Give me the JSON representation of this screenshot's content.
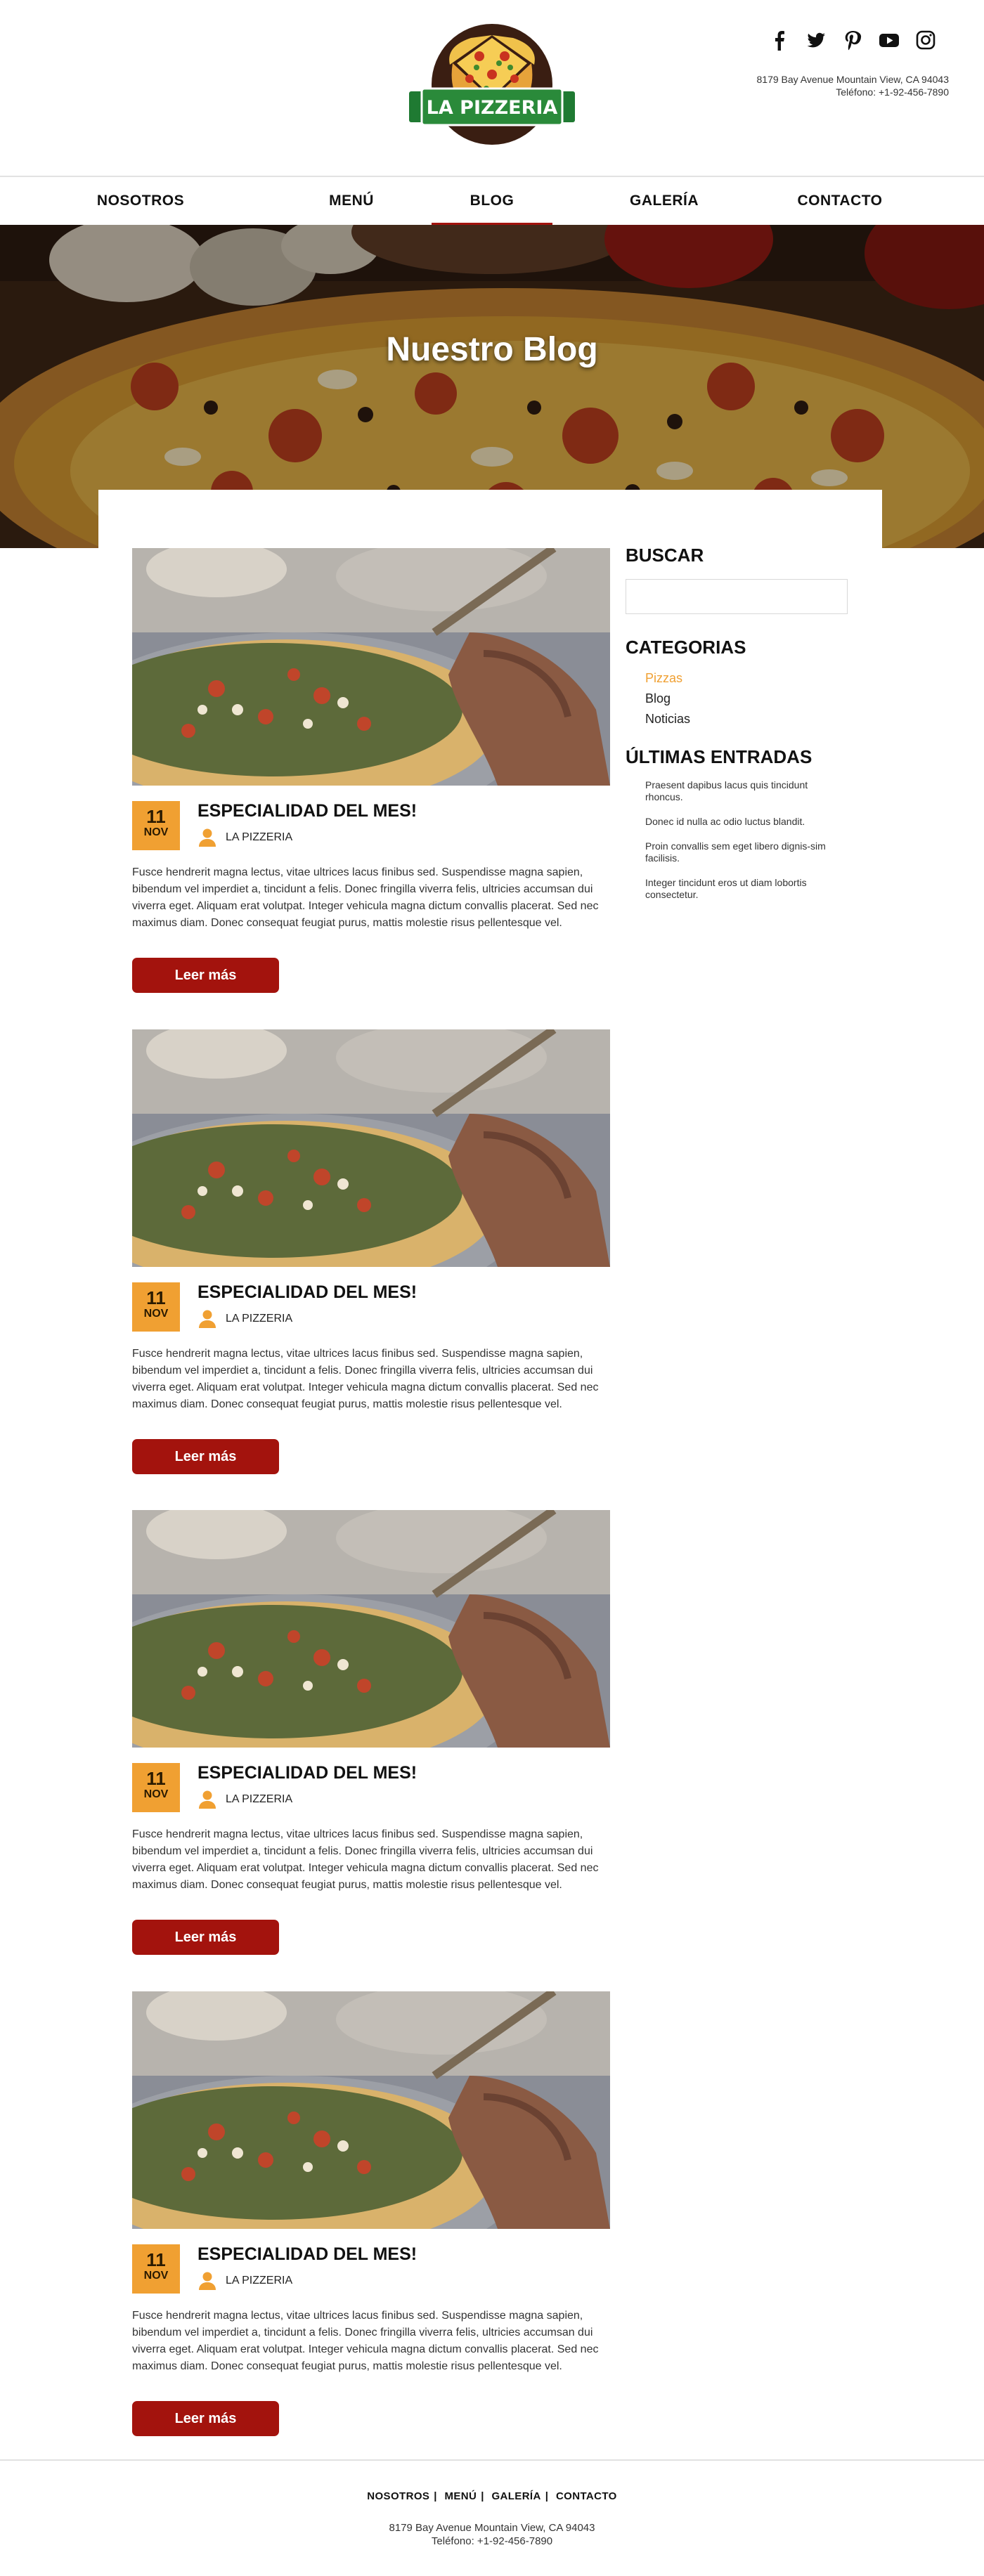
{
  "brand": {
    "name": "LA PIZZERIA"
  },
  "header": {
    "address_line1": "8179 Bay Avenue  Mountain View, CA 94043",
    "address_line2": "Teléfono: +1-92-456-7890",
    "social": [
      "facebook-icon",
      "twitter-icon",
      "pinterest-icon",
      "youtube-icon",
      "instagram-icon"
    ]
  },
  "nav": {
    "items": [
      {
        "label": "NOSOTROS"
      },
      {
        "label": "MENÚ"
      },
      {
        "label": "BLOG"
      },
      {
        "label": "GALERÍA"
      },
      {
        "label": "CONTACTO"
      }
    ],
    "active": "BLOG"
  },
  "hero": {
    "title": "Nuestro Blog"
  },
  "posts": [
    {
      "day": "11",
      "month": "NOV",
      "title": "ESPECIALIDAD DEL MES!",
      "author": "LA PIZZERIA",
      "excerpt": "Fusce hendrerit magna lectus, vitae ultrices lacus finibus sed. Suspendisse magna sapien, bibendum vel imperdiet a, tincidunt a felis. Donec fringilla viverra felis, ultricies accumsan dui viverra eget. Aliquam erat volutpat. Integer vehicula magna dictum convallis placerat. Sed nec maximus diam. Donec consequat feugiat purus, mattis molestie risus pellentesque vel.",
      "button": "Leer más"
    },
    {
      "day": "11",
      "month": "NOV",
      "title": "ESPECIALIDAD DEL MES!",
      "author": "LA PIZZERIA",
      "excerpt": "Fusce hendrerit magna lectus, vitae ultrices lacus finibus sed. Suspendisse magna sapien, bibendum vel imperdiet a, tincidunt a felis. Donec fringilla viverra felis, ultricies accumsan dui viverra eget. Aliquam erat volutpat. Integer vehicula magna dictum convallis placerat. Sed nec maximus diam. Donec consequat feugiat purus, mattis molestie risus pellentesque vel.",
      "button": "Leer más"
    },
    {
      "day": "11",
      "month": "NOV",
      "title": "ESPECIALIDAD DEL MES!",
      "author": "LA PIZZERIA",
      "excerpt": "Fusce hendrerit magna lectus, vitae ultrices lacus finibus sed. Suspendisse magna sapien, bibendum vel imperdiet a, tincidunt a felis. Donec fringilla viverra felis, ultricies accumsan dui viverra eget. Aliquam erat volutpat. Integer vehicula magna dictum convallis placerat. Sed nec maximus diam. Donec consequat feugiat purus, mattis molestie risus pellentesque vel.",
      "button": "Leer más"
    },
    {
      "day": "11",
      "month": "NOV",
      "title": "ESPECIALIDAD DEL MES!",
      "author": "LA PIZZERIA",
      "excerpt": "Fusce hendrerit magna lectus, vitae ultrices lacus finibus sed. Suspendisse magna sapien, bibendum vel imperdiet a, tincidunt a felis. Donec fringilla viverra felis, ultricies accumsan dui viverra eget. Aliquam erat volutpat. Integer vehicula magna dictum convallis placerat. Sed nec maximus diam. Donec consequat feugiat purus, mattis molestie risus pellentesque vel.",
      "button": "Leer más"
    }
  ],
  "sidebar": {
    "search_heading": "BUSCAR",
    "search_placeholder": "",
    "categories_heading": "CATEGORIAS",
    "categories": [
      {
        "label": "Pizzas",
        "active": true
      },
      {
        "label": "Blog",
        "active": false
      },
      {
        "label": "Noticias",
        "active": false
      }
    ],
    "recent_heading": "ÚLTIMAS ENTRADAS",
    "recent": [
      "Praesent dapibus lacus quis tincidunt rhoncus.",
      "Donec id nulla ac odio luctus blandit.",
      "Proin convallis sem eget libero dignis-sim facilisis.",
      "Integer tincidunt eros ut diam lobortis consectetur."
    ]
  },
  "footer": {
    "links": [
      "NOSOTROS",
      "MENÚ",
      "GALERÍA",
      "CONTACTO"
    ],
    "separator": "|",
    "address_line1": "8179 Bay Avenue  Mountain View, CA 94043",
    "address_line2": "Teléfono: +1-92-456-7890"
  },
  "colors": {
    "brand_red": "#a3130d",
    "accent_orange": "#f0a032",
    "logo_green": "#1f7a32"
  }
}
